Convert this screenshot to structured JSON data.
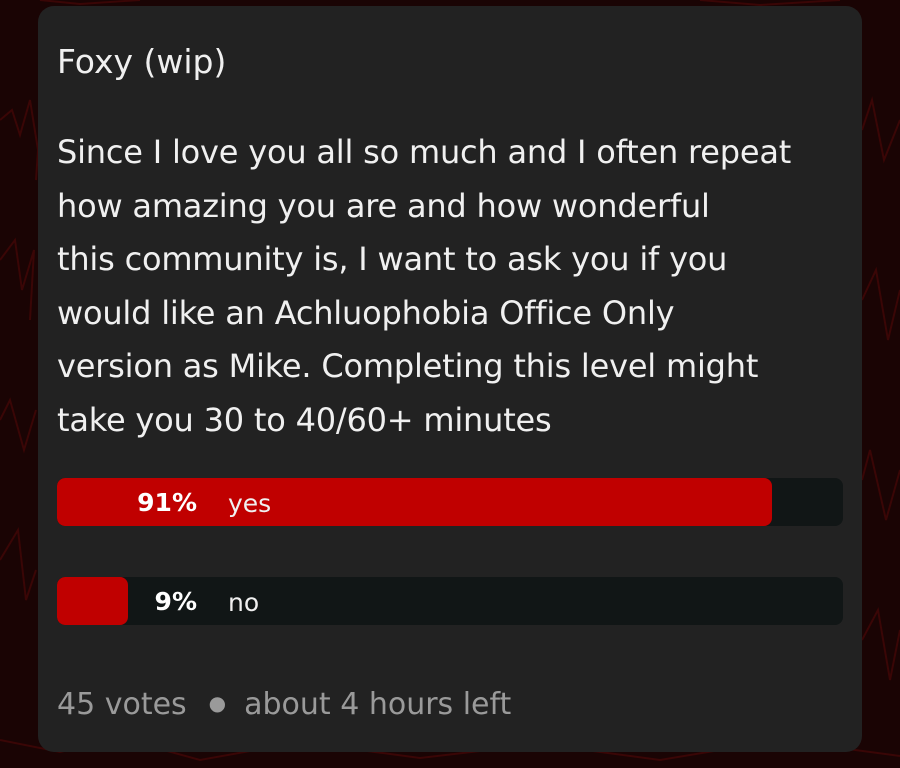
{
  "post": {
    "title": "Foxy (wip)",
    "body": "Since I love you all so much and I often repeat\nhow amazing you are and how wonderful\nthis community is, I want to ask you if you\nwould like an Achluophobia Office Only\nversion as Mike. Completing this level might\ntake you 30 to 40/60+ minutes"
  },
  "poll": {
    "options": [
      {
        "percent_text": "91%",
        "label": "yes",
        "percent": 91
      },
      {
        "percent_text": "9%",
        "label": "no",
        "percent": 9
      }
    ],
    "votes": "45 votes",
    "time_left": "about 4 hours left"
  },
  "colors": {
    "accent": "#c00000",
    "card": "#222222",
    "track": "#111616",
    "background": "#1a0404"
  }
}
